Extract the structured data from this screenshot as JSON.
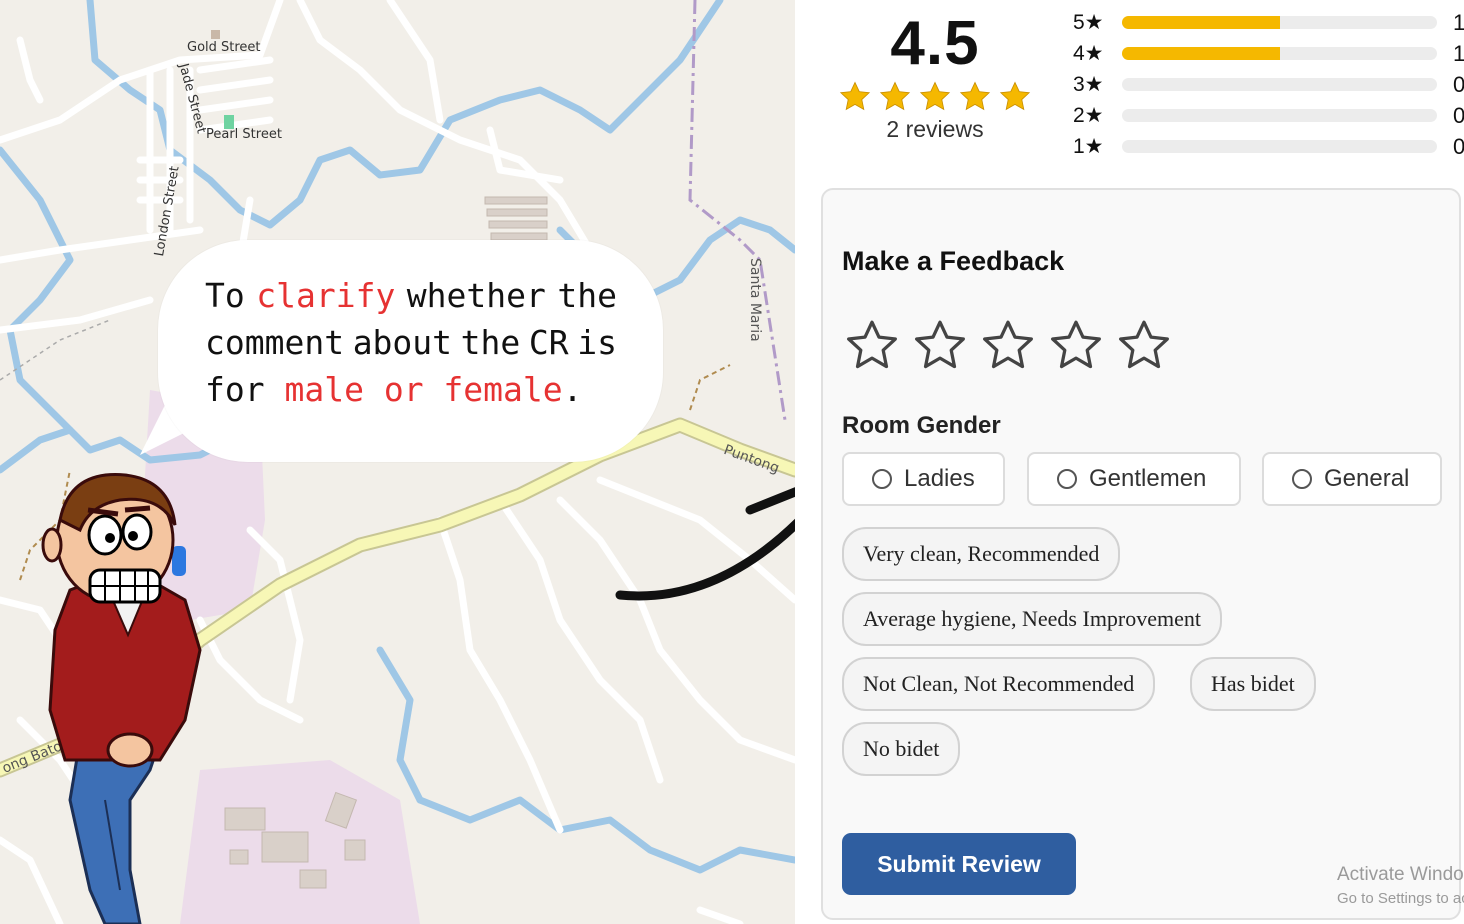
{
  "map": {
    "streets": {
      "gold": "Gold Street",
      "jade": "Jade Street",
      "pearl": "Pearl Street",
      "london": "London Street",
      "santa_maria": "Santa Maria",
      "puntong": "Puntong",
      "bato": "ong Bato-La"
    },
    "colors": {
      "water": "#9fc7e6",
      "main_road": "#f7f7b6",
      "landuse": "#ecdcea"
    }
  },
  "bubble": {
    "line1_words": [
      "To",
      "clarify",
      "whether",
      "the"
    ],
    "line2_words": [
      "comment",
      "about",
      "the",
      "CR",
      "is"
    ],
    "line3_prefix": "for ",
    "line3_highlight": "male or female",
    "line3_suffix": "."
  },
  "summary": {
    "average": "4.5",
    "reviews": "2 reviews",
    "stars_filled": 5
  },
  "distribution": [
    {
      "label": "5★",
      "count": "1",
      "fraction": 0.5
    },
    {
      "label": "4★",
      "count": "1",
      "fraction": 0.5
    },
    {
      "label": "3★",
      "count": "0",
      "fraction": 0
    },
    {
      "label": "2★",
      "count": "0",
      "fraction": 0
    },
    {
      "label": "1★",
      "count": "0",
      "fraction": 0
    }
  ],
  "feedback": {
    "title": "Make a Feedback",
    "room_gender_label": "Room Gender",
    "genders": [
      "Ladies",
      "Gentlemen",
      "General"
    ],
    "tags": [
      "Very clean, Recommended",
      "Average hygiene, Needs Improvement",
      "Not Clean, Not Recommended",
      "Has bidet",
      "No bidet"
    ],
    "submit_label": "Submit Review"
  },
  "watermark": {
    "line1": "Activate Windo",
    "line2": "Go to Settings to ac"
  },
  "colors": {
    "star_gold": "#f5b800",
    "submit_blue": "#2f5ea0",
    "highlight_red": "#e63232"
  }
}
